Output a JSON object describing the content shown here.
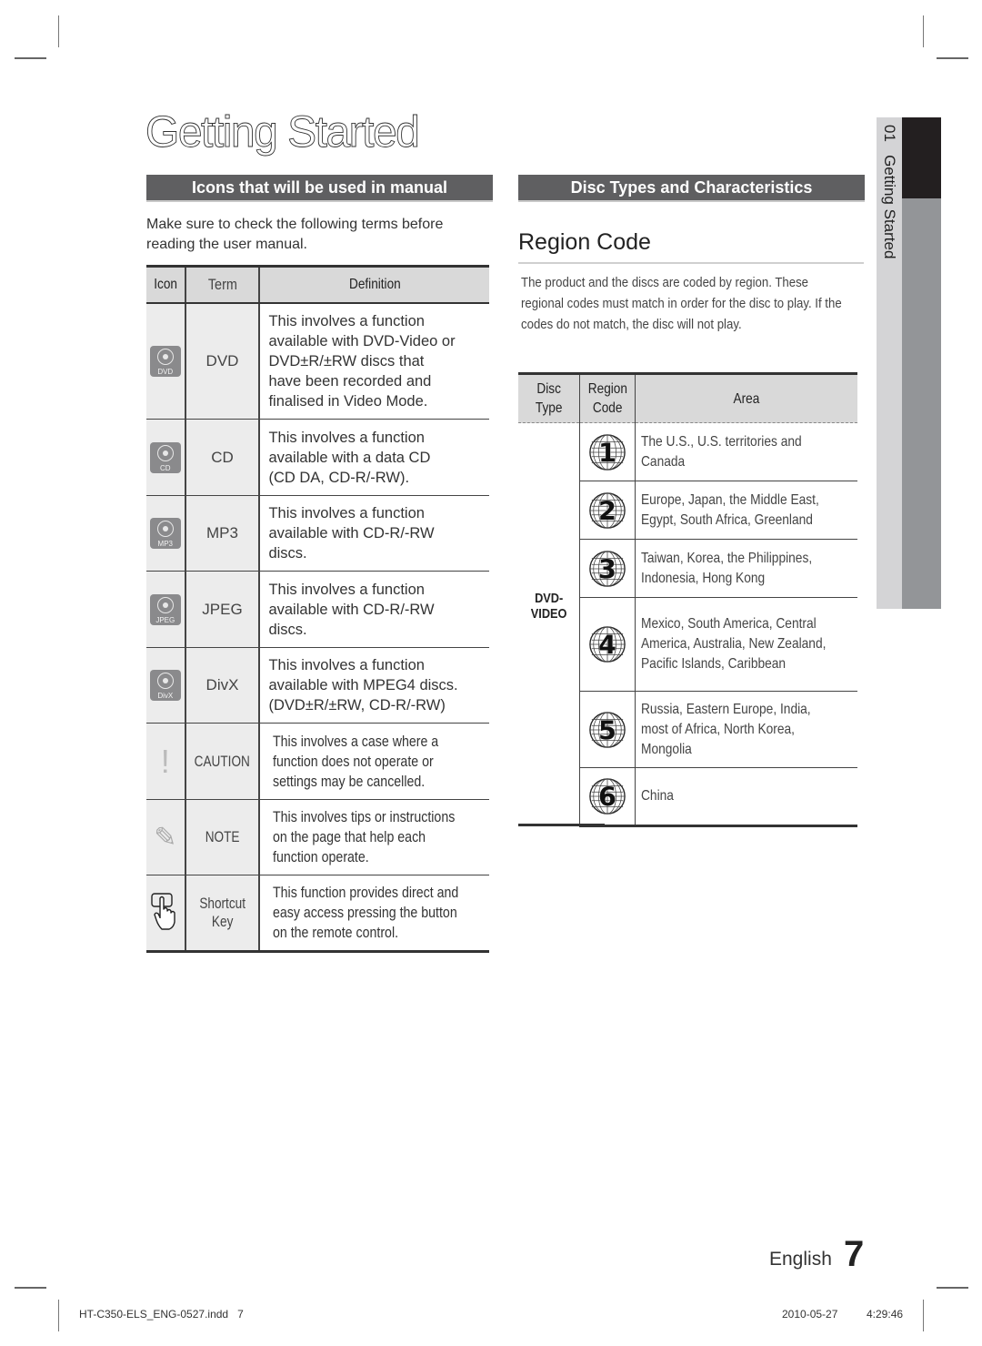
{
  "page": {
    "title": "Getting Started",
    "language": "English",
    "page_number": "7"
  },
  "side_tab": {
    "chapter": "01",
    "label": "Getting Started",
    "text": "01   Getting Started"
  },
  "left": {
    "section_title": "Icons that will be used in manual",
    "intro_line1": "Make sure to check the following terms before",
    "intro_line2": "reading the user manual.",
    "table": {
      "headers": {
        "icon": "Icon",
        "term": "Term",
        "definition": "Definition"
      },
      "rows": [
        {
          "icon": "dvd-disc-icon",
          "icon_label": "DVD",
          "term": "DVD",
          "definition_lines": [
            "This involves a function",
            "available with DVD-Video or",
            "DVD±R/±RW discs that",
            "have been recorded and",
            "finalised in Video Mode."
          ]
        },
        {
          "icon": "cd-disc-icon",
          "icon_label": "CD",
          "term": "CD",
          "definition_lines": [
            "This involves a function",
            "available with a data CD",
            "(CD DA, CD-R/-RW)."
          ]
        },
        {
          "icon": "mp3-disc-icon",
          "icon_label": "MP3",
          "term": "MP3",
          "definition_lines": [
            "This involves a function",
            "available with CD-R/-RW",
            "discs."
          ]
        },
        {
          "icon": "jpeg-disc-icon",
          "icon_label": "JPEG",
          "term": "JPEG",
          "definition_lines": [
            "This involves a function",
            "available with CD-R/-RW",
            "discs."
          ]
        },
        {
          "icon": "divx-disc-icon",
          "icon_label": "DivX",
          "term": "DivX",
          "definition_lines": [
            "This involves a function",
            "available with MPEG4 discs.",
            "(DVD±R/±RW, CD-R/-RW)"
          ]
        },
        {
          "icon": "caution-icon",
          "icon_glyph": "!",
          "term": "CAUTION",
          "definition_lines": [
            "This involves a case where a",
            "function does not operate or",
            "settings may be cancelled."
          ]
        },
        {
          "icon": "note-pencil-icon",
          "icon_glyph": "✎",
          "term": "NOTE",
          "definition_lines": [
            "This involves tips or instructions",
            "on the page that help each",
            "function operate."
          ]
        },
        {
          "icon": "shortcut-hand-icon",
          "term_line1": "Shortcut",
          "term_line2": "Key",
          "definition_lines": [
            "This function provides direct and",
            "easy access pressing the button",
            "on the remote control."
          ]
        }
      ]
    }
  },
  "right": {
    "section_title": "Disc Types and Characteristics",
    "subheading": "Region Code",
    "intro_lines": [
      "The product and the discs are coded by region. These",
      "regional codes must match in order for the disc to play. If the",
      "codes do not match, the disc will not play."
    ],
    "table": {
      "headers": {
        "disc_type": "Disc Type",
        "region_code_line1": "Region",
        "region_code_line2": "Code",
        "area": "Area"
      },
      "disc_type": "DVD-VIDEO",
      "rows": [
        {
          "code": "1",
          "area_lines": [
            "The U.S., U.S. territories and",
            "Canada"
          ]
        },
        {
          "code": "2",
          "area_lines": [
            "Europe, Japan, the Middle East,",
            "Egypt, South Africa, Greenland"
          ]
        },
        {
          "code": "3",
          "area_lines": [
            "Taiwan, Korea, the Philippines,",
            "Indonesia, Hong Kong"
          ]
        },
        {
          "code": "4",
          "area_lines": [
            "Mexico, South America, Central",
            "America, Australia, New Zealand,",
            "Pacific Islands, Caribbean"
          ]
        },
        {
          "code": "5",
          "area_lines": [
            "Russia, Eastern Europe, India,",
            "most of Africa, North Korea,",
            "Mongolia"
          ]
        },
        {
          "code": "6",
          "area_lines": [
            "China"
          ]
        }
      ]
    }
  },
  "slug": {
    "filename": "HT-C350-ELS_ENG-0527.indd   7",
    "date": "2010-05-27",
    "time": "4:29:46"
  },
  "colors": {
    "section_bar": "#5f5f61",
    "table_header": "#d9d9d9",
    "icon_cell": "#ececec",
    "tab_dark": "#231f20",
    "tab_mid": "#939598",
    "tab_light": "#d4d4d6"
  }
}
